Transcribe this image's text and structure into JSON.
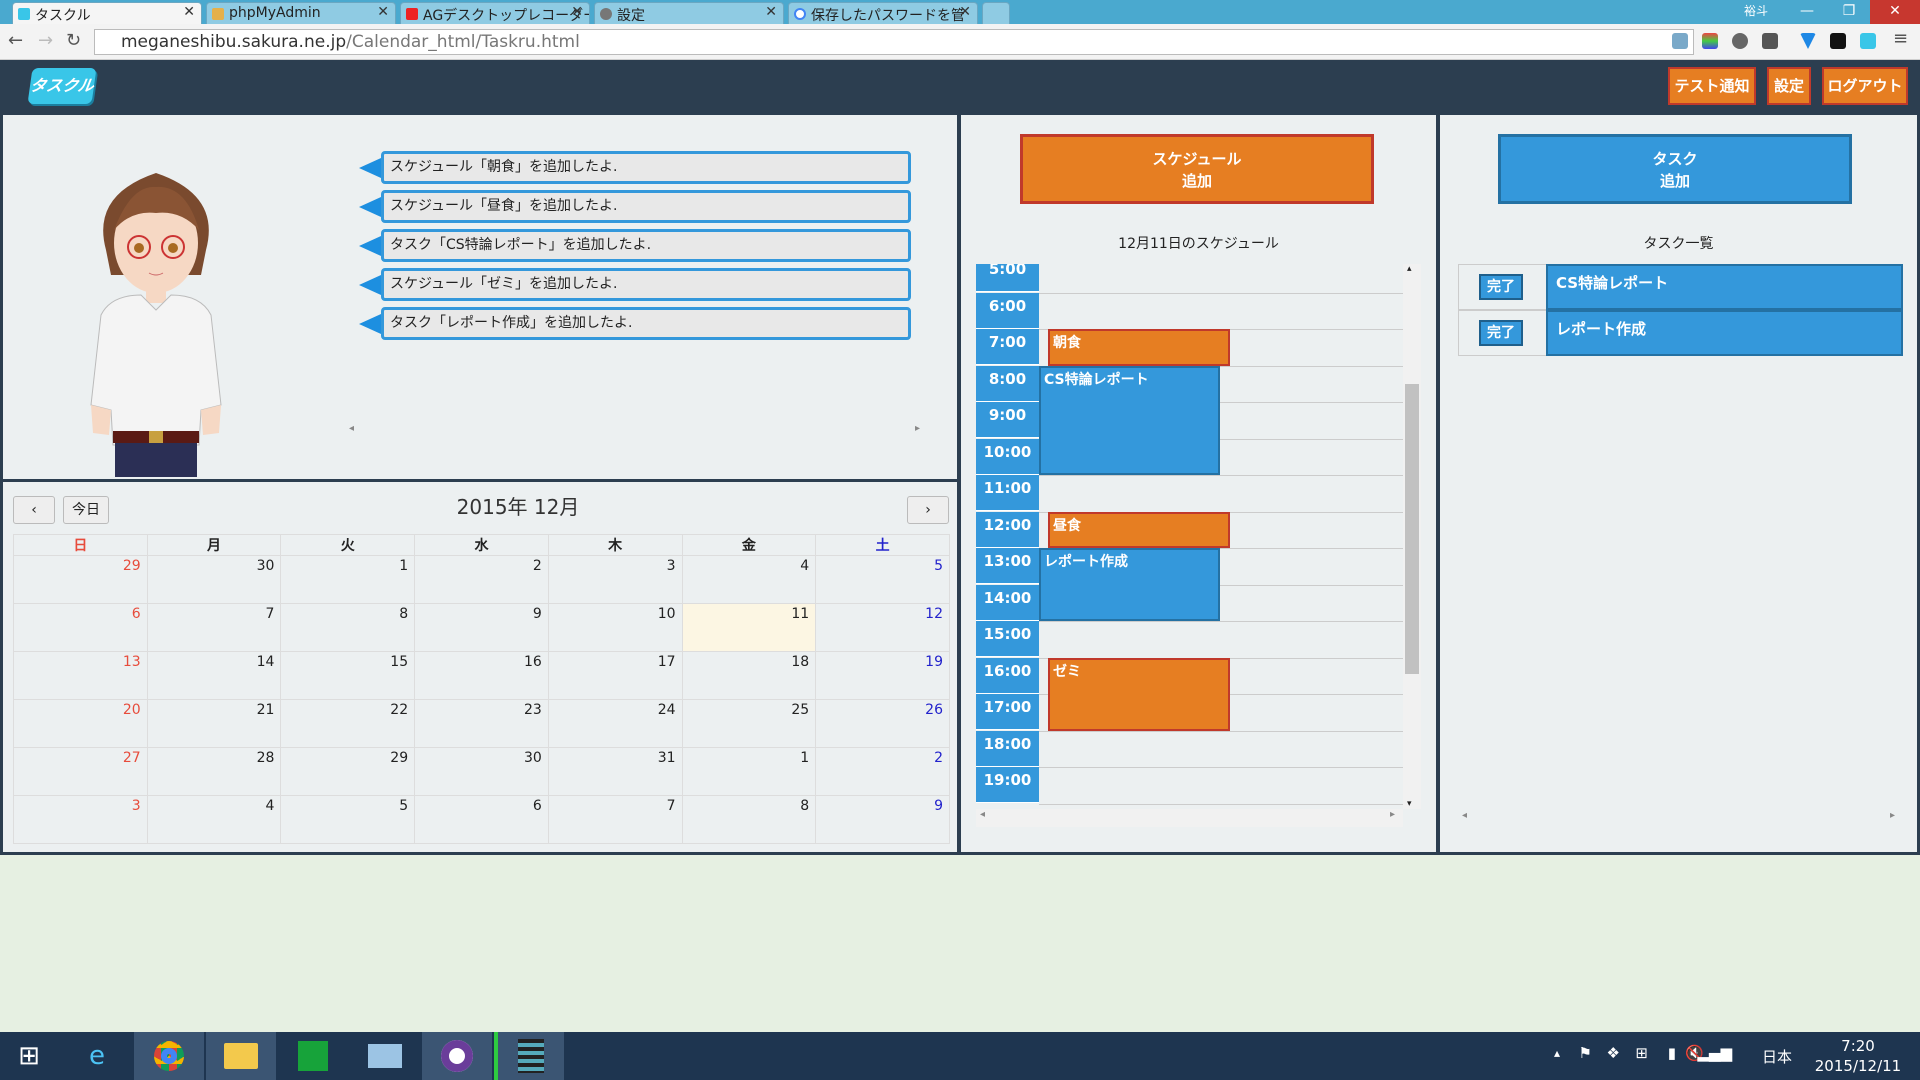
{
  "browser": {
    "tabs": [
      {
        "label": "タスクル",
        "active": true
      },
      {
        "label": "phpMyAdmin"
      },
      {
        "label": "AGデスクトップレコーダー"
      },
      {
        "label": "設定"
      },
      {
        "label": "保存したパスワードを管"
      }
    ],
    "profile": "裕斗",
    "url_host": "meganeshibu.sakura.ne.jp",
    "url_path": "/Calendar_html/Taskru.html"
  },
  "header": {
    "logo": "タスクル",
    "buttons": [
      "テスト通知",
      "設定",
      "ログアウト"
    ]
  },
  "chat": {
    "messages": [
      "スケジュール「朝食」を追加したよ.",
      "スケジュール「昼食」を追加したよ.",
      "タスク「CS特論レポート」を追加したよ.",
      "スケジュール「ゼミ」を追加したよ.",
      "タスク「レポート作成」を追加したよ."
    ]
  },
  "calendar": {
    "title": "2015年 12月",
    "today_label": "今日",
    "weekdays": [
      "日",
      "月",
      "火",
      "水",
      "木",
      "金",
      "土"
    ],
    "weeks": [
      [
        "29",
        "30",
        "1",
        "2",
        "3",
        "4",
        "5"
      ],
      [
        "6",
        "7",
        "8",
        "9",
        "10",
        "11",
        "12"
      ],
      [
        "13",
        "14",
        "15",
        "16",
        "17",
        "18",
        "19"
      ],
      [
        "20",
        "21",
        "22",
        "23",
        "24",
        "25",
        "26"
      ],
      [
        "27",
        "28",
        "29",
        "30",
        "31",
        "1",
        "2"
      ],
      [
        "3",
        "4",
        "5",
        "6",
        "7",
        "8",
        "9"
      ]
    ],
    "today": "11"
  },
  "schedule": {
    "add_button": {
      "line1": "スケジュール",
      "line2": "追加"
    },
    "title": "12月11日のスケジュール",
    "hours": [
      "5:00",
      "6:00",
      "7:00",
      "8:00",
      "9:00",
      "10:00",
      "11:00",
      "12:00",
      "13:00",
      "14:00",
      "15:00",
      "16:00",
      "17:00",
      "18:00",
      "19:00"
    ],
    "events": [
      {
        "name": "朝食",
        "start": 7.0,
        "end": 8.0,
        "kind": "schedule"
      },
      {
        "name": "CS特論レポート",
        "start": 8.0,
        "end": 11.0,
        "kind": "task"
      },
      {
        "name": "昼食",
        "start": 12.0,
        "end": 13.0,
        "kind": "schedule"
      },
      {
        "name": "レポート作成",
        "start": 13.0,
        "end": 15.0,
        "kind": "task"
      },
      {
        "name": "ゼミ",
        "start": 16.0,
        "end": 18.0,
        "kind": "schedule"
      }
    ]
  },
  "tasks": {
    "add_button": {
      "line1": "タスク",
      "line2": "追加"
    },
    "title": "タスク一覧",
    "done_label": "完了",
    "items": [
      "CS特論レポート",
      "レポート作成"
    ]
  },
  "taskbar": {
    "language": "日本",
    "time": "7:20",
    "date": "2015/12/11"
  },
  "colors": {
    "orange": "#e67e22",
    "blue": "#3498db",
    "navy": "#2c3e50"
  }
}
